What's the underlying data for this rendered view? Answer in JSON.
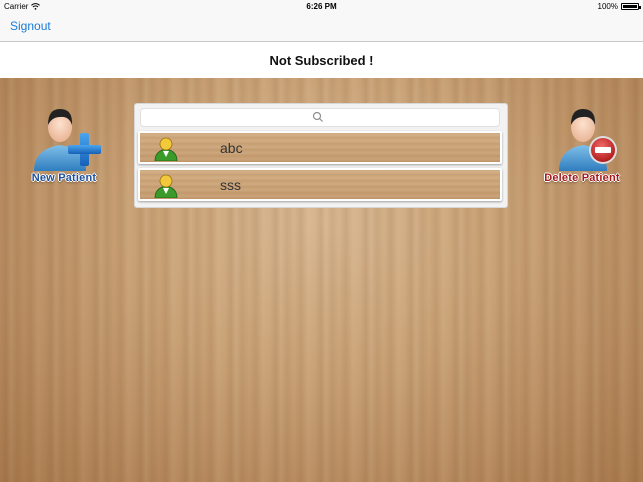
{
  "status_bar": {
    "carrier": "Carrier",
    "time": "6:26 PM",
    "battery": "100%"
  },
  "nav": {
    "signout_label": "Signout"
  },
  "header": {
    "title": "Not Subscribed !"
  },
  "actions": {
    "new_patient_label": "New Patient",
    "delete_patient_label": "Delete Patient"
  },
  "search": {
    "placeholder": ""
  },
  "patients": [
    {
      "name": "abc"
    },
    {
      "name": "sss"
    }
  ],
  "colors": {
    "accent": "#1a7bd6",
    "new_patient_text": "#1d4f9c",
    "delete_patient_text": "#a3181a",
    "wood": "#c79f73"
  }
}
